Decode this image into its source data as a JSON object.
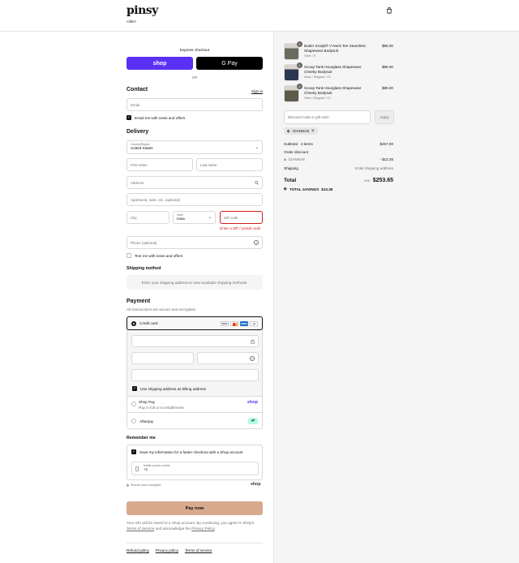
{
  "brand": {
    "name": "pinsy",
    "sub": "</div>"
  },
  "express": {
    "label": "Express checkout",
    "shop_pay": "shop",
    "gpay": "G Pay",
    "or": "OR"
  },
  "contact": {
    "title": "Contact",
    "sign_in": "Sign in",
    "email_placeholder": "Email",
    "news_label": "Email me with news and offers"
  },
  "delivery": {
    "title": "Delivery",
    "country_label": "Country/Region",
    "country_value": "United States",
    "first_name": "First name",
    "last_name": "Last name",
    "address": "Address",
    "apartment": "Apartment, suite, etc. (optional)",
    "city": "City",
    "state_label": "State",
    "state_value": "Iowa",
    "zip": "ZIP code",
    "zip_error": "Enter a ZIP / postal code",
    "phone": "Phone (optional)",
    "text_news": "Text me with news and offers"
  },
  "shipping": {
    "title": "Shipping method",
    "note": "Enter your shipping address to view available shipping methods."
  },
  "payment": {
    "title": "Payment",
    "secure_note": "All transactions are secure and encrypted.",
    "credit_card": "Credit card",
    "more_cards": "+5",
    "card_brands": [
      "VISA",
      "MC",
      "AMEX"
    ],
    "billing_same": "Use shipping address as billing address",
    "shop_pay": "Shop Pay",
    "shop_pay_sub": "Pay in full or in installments",
    "shop_pay_logo": "shop",
    "afterpay": "Afterpay"
  },
  "remember": {
    "title": "Remember me",
    "save_info": "Save my information for a faster checkout with a Shop account",
    "mobile_label": "Mobile phone number",
    "mobile_value": "+1",
    "secure": "Secure and encrypted",
    "shop_logo": "shop"
  },
  "pay_button": "Pay now",
  "disclaimer": {
    "text1": "Your info will be saved to a Shop account. By continuing, you agree to Shop's",
    "tos": "Terms of Service",
    "text2": "and acknowledge the",
    "privacy": "Privacy Policy",
    "period": "."
  },
  "footer": [
    "Refund policy",
    "Privacy policy",
    "Terms of service"
  ],
  "order": {
    "items": [
      {
        "qty": "1",
        "name": "Butter Sculpt® V Neck Tee Seamless Shapewear Bodysuit",
        "variant": "Olive / S",
        "price": "$89.00",
        "color": "#6b6b5e"
      },
      {
        "qty": "1",
        "name": "Scoop Tank Hourglass Shapewear Cheeky Bodysuit",
        "variant": "Navy / Regular / 2X",
        "price": "$89.00",
        "color": "#2d3652"
      },
      {
        "qty": "1",
        "name": "Scoop Tank Hourglass Shapewear Cheeky Bodysuit",
        "variant": "Olive / Regular / 2X",
        "price": "$89.00",
        "color": "#5e5a48"
      }
    ],
    "discount_placeholder": "Discount code or gift card",
    "apply": "Apply",
    "code_tag": "GIANNA8",
    "subtotal_label": "Subtotal · 3 items",
    "subtotal_value": "$267.00",
    "order_discount_label": "Order discount",
    "discount_code": "GIANNA8",
    "discount_value": "- $13.35",
    "shipping_label": "Shipping",
    "shipping_value": "Enter shipping address",
    "total_label": "Total",
    "currency": "USD",
    "total_value": "$253.65",
    "savings_label": "TOTAL SAVINGS",
    "savings_value": "$13.35"
  }
}
